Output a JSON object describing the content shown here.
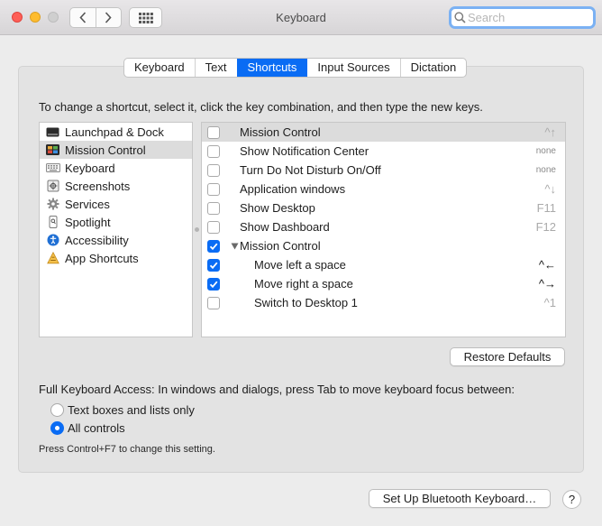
{
  "window": {
    "title": "Keyboard"
  },
  "search": {
    "placeholder": "Search",
    "value": ""
  },
  "tabs": [
    {
      "label": "Keyboard",
      "active": false
    },
    {
      "label": "Text",
      "active": false
    },
    {
      "label": "Shortcuts",
      "active": true
    },
    {
      "label": "Input Sources",
      "active": false
    },
    {
      "label": "Dictation",
      "active": false
    }
  ],
  "instruction": "To change a shortcut, select it, click the key combination, and then type the new keys.",
  "categories": [
    {
      "label": "Launchpad & Dock",
      "icon": "launchpad-icon",
      "selected": false
    },
    {
      "label": "Mission Control",
      "icon": "mission-control-icon",
      "selected": true
    },
    {
      "label": "Keyboard",
      "icon": "keyboard-icon",
      "selected": false
    },
    {
      "label": "Screenshots",
      "icon": "screenshot-icon",
      "selected": false
    },
    {
      "label": "Services",
      "icon": "gear-icon",
      "selected": false
    },
    {
      "label": "Spotlight",
      "icon": "spotlight-icon",
      "selected": false
    },
    {
      "label": "Accessibility",
      "icon": "accessibility-icon",
      "selected": false
    },
    {
      "label": "App Shortcuts",
      "icon": "app-shortcuts-icon",
      "selected": false
    }
  ],
  "shortcuts": [
    {
      "label": "Mission Control",
      "key": "^↑",
      "checked": false
    },
    {
      "label": "Show Notification Center",
      "key": "none",
      "checked": false
    },
    {
      "label": "Turn Do Not Disturb On/Off",
      "key": "none",
      "checked": false
    },
    {
      "label": "Application windows",
      "key": "^↓",
      "checked": false
    },
    {
      "label": "Show Desktop",
      "key": "F11",
      "checked": false
    },
    {
      "label": "Show Dashboard",
      "key": "F12",
      "checked": false
    },
    {
      "label": "Mission Control",
      "key": "",
      "checked": true
    },
    {
      "label": "Move left a space",
      "key": "^←",
      "checked": true
    },
    {
      "label": "Move right a space",
      "key": "^→",
      "checked": true
    },
    {
      "label": "Switch to Desktop 1",
      "key": "^1",
      "checked": false
    }
  ],
  "buttons": {
    "restore_defaults": "Restore Defaults",
    "bluetooth": "Set Up Bluetooth Keyboard…",
    "help": "?"
  },
  "keyboard_access": {
    "label": "Full Keyboard Access: In windows and dialogs, press Tab to move keyboard focus between:",
    "options": [
      {
        "label": "Text boxes and lists only",
        "selected": false
      },
      {
        "label": "All controls",
        "selected": true
      }
    ],
    "note": "Press Control+F7 to change this setting."
  },
  "colors": {
    "accent": "#0a6cf4",
    "close": "#fe5f57",
    "minimize": "#febc2e"
  }
}
